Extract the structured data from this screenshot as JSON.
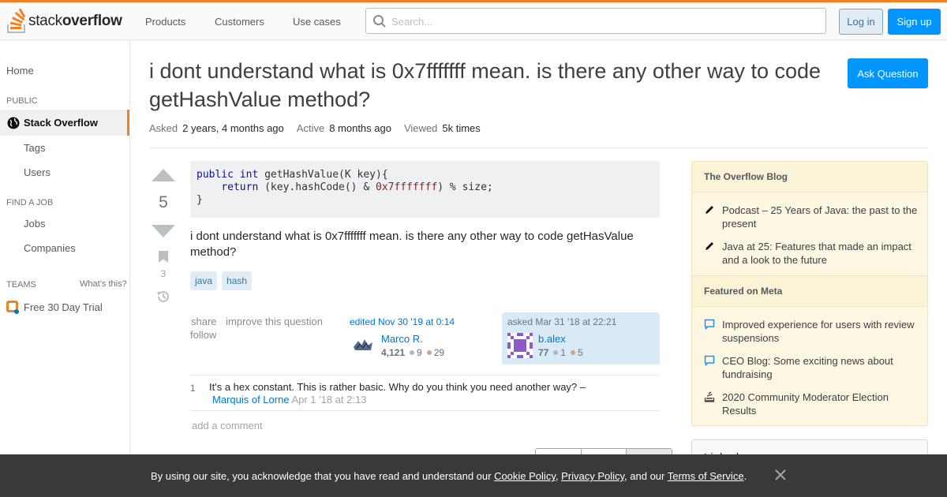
{
  "brand": {
    "logo_regular": "stack",
    "logo_bold": "overflow",
    "accent": "#f48024",
    "primary": "#0095ff"
  },
  "topbar": {
    "nav": [
      "Products",
      "Customers",
      "Use cases"
    ],
    "search_placeholder": "Search...",
    "login_label": "Log in",
    "signup_label": "Sign up"
  },
  "sidebar": {
    "home": "Home",
    "public_heading": "PUBLIC",
    "stack_overflow": "Stack Overflow",
    "tags": "Tags",
    "users": "Users",
    "findjob_heading": "FIND A JOB",
    "jobs": "Jobs",
    "companies": "Companies",
    "teams_heading": "TEAMS",
    "whats_this": "What’s this?",
    "free_trial": "Free 30 Day Trial"
  },
  "question": {
    "title": "i dont understand what is 0x7fffffff mean. is there any other way to code getHashValue method?",
    "ask_button": "Ask Question",
    "asked_label": "Asked",
    "asked_value": "2 years, 4 months ago",
    "active_label": "Active",
    "active_value": "8 months ago",
    "viewed_label": "Viewed",
    "viewed_value": "5k times",
    "votes": "5",
    "bookmarks": "3",
    "code": {
      "line1_kw1": "public",
      "line1_kw2": "int",
      "line1_rest": " getHashValue(K key){",
      "line2_kw": "return",
      "line2_mid": " (key.hashCode() & ",
      "line2_lit": "0x7fffffff",
      "line2_end": ") % size;",
      "line3": "}"
    },
    "body": "i dont understand what is 0x7fffffff mean. is there any other way to code getHasValue method?",
    "tags": [
      "java",
      "hash"
    ],
    "menu": {
      "share": "share",
      "improve": "improve this question",
      "follow": "follow"
    },
    "editor": {
      "action": "edited Nov 30 '19 at 0:14",
      "name": "Marco R.",
      "rep": "4,121",
      "silver": "9",
      "bronze": "29"
    },
    "asker": {
      "action": "asked Mar 31 '18 at 22:21",
      "name": "b.alex",
      "rep": "77",
      "silver": "1",
      "bronze": "5"
    }
  },
  "comments": [
    {
      "score": "1",
      "text": "It's a hex constant. This is rather basic. Why do you think you need another way? –",
      "user": "Marquis of Lorne",
      "date": "Apr 1 '18 at 2:13"
    }
  ],
  "add_comment": "add a comment",
  "blog": {
    "heading1": "The Overflow Blog",
    "items1": [
      "Podcast – 25 Years of Java: the past to the present",
      "Java at 25: Features that made an impact and a look to the future"
    ],
    "heading2": "Featured on Meta",
    "items2": [
      "Improved experience for users with review suspensions",
      "CEO Blog: Some exciting news about fundraising",
      "2020 Community Moderator Election Results"
    ]
  },
  "related": {
    "title": "Linked"
  },
  "cookie": {
    "prefix": "By using our site, you acknowledge that you have read and understand our ",
    "cookie_policy": "Cookie Policy",
    "sep1": ", ",
    "privacy_policy": "Privacy Policy",
    "sep2": ", and our ",
    "terms": "Terms of Service",
    "suffix": "."
  }
}
